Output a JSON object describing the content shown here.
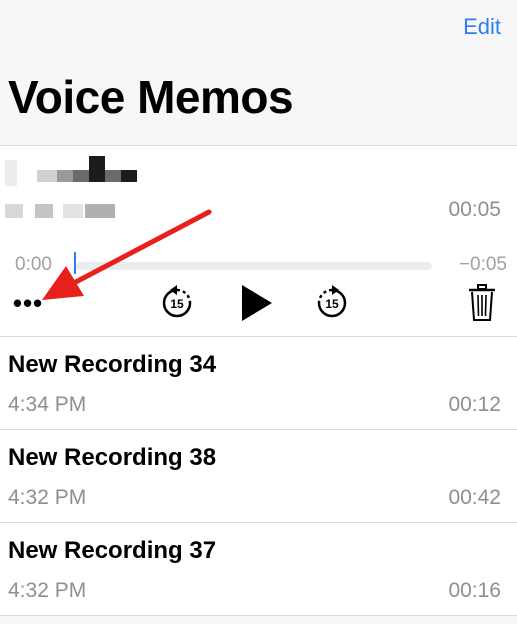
{
  "header": {
    "edit_label": "Edit",
    "title": "Voice Memos"
  },
  "current": {
    "duration": "00:05",
    "scrub_elapsed": "0:00",
    "scrub_remaining": "−0:05",
    "progress_fraction": 0.0,
    "controls": {
      "more_label": "•••",
      "skip_back_seconds": "15",
      "skip_forward_seconds": "15"
    }
  },
  "recordings": [
    {
      "name": "New Recording 34",
      "time": "4:34 PM",
      "duration": "00:12"
    },
    {
      "name": "New Recording 38",
      "time": "4:32 PM",
      "duration": "00:42"
    },
    {
      "name": "New Recording 37",
      "time": "4:32 PM",
      "duration": "00:16"
    }
  ],
  "colors": {
    "accent": "#2f7cf6",
    "annotation_arrow": "#e8201c",
    "secondary_text": "#8e8e93"
  }
}
